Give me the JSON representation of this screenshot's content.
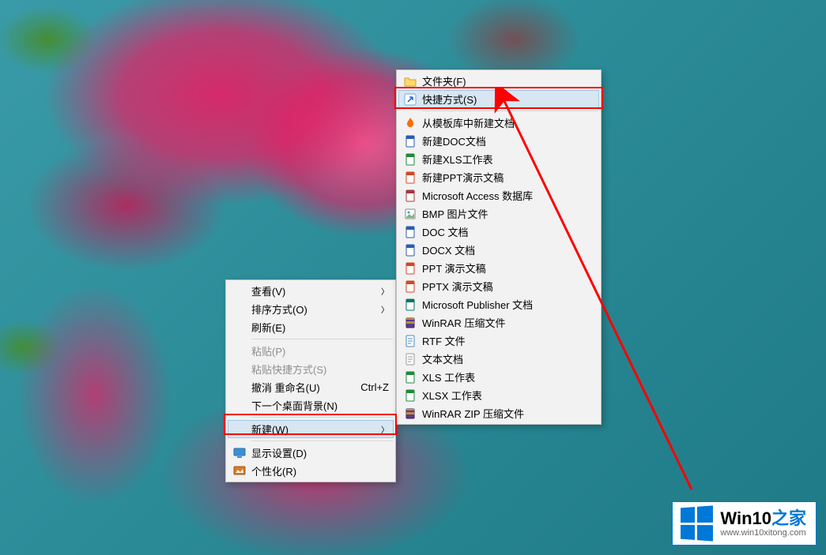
{
  "context_menu": {
    "view": "查看(V)",
    "sort": "排序方式(O)",
    "refresh": "刷新(E)",
    "paste": "粘贴(P)",
    "paste_shortcut": "粘贴快捷方式(S)",
    "undo_rename": "撤消 重命名(U)",
    "undo_shortcut": "Ctrl+Z",
    "next_bg": "下一个桌面背景(N)",
    "new": "新建(W)",
    "display": "显示设置(D)",
    "personalize": "个性化(R)"
  },
  "new_submenu": {
    "items": [
      {
        "label": "文件夹(F)",
        "icon": "folder"
      },
      {
        "label": "快捷方式(S)",
        "icon": "shortcut",
        "highlight": true
      },
      {
        "label": "从模板库中新建文档",
        "icon": "flame"
      },
      {
        "label": "新建DOC文档",
        "icon": "doc"
      },
      {
        "label": "新建XLS工作表",
        "icon": "xls"
      },
      {
        "label": "新建PPT演示文稿",
        "icon": "ppt"
      },
      {
        "label": "Microsoft Access 数据库",
        "icon": "access"
      },
      {
        "label": "BMP 图片文件",
        "icon": "bmp"
      },
      {
        "label": "DOC 文档",
        "icon": "doc"
      },
      {
        "label": "DOCX 文档",
        "icon": "doc"
      },
      {
        "label": "PPT 演示文稿",
        "icon": "ppt"
      },
      {
        "label": "PPTX 演示文稿",
        "icon": "ppt"
      },
      {
        "label": "Microsoft Publisher 文档",
        "icon": "pub"
      },
      {
        "label": "WinRAR 压缩文件",
        "icon": "rar"
      },
      {
        "label": "RTF 文件",
        "icon": "rtf"
      },
      {
        "label": "文本文档",
        "icon": "txt"
      },
      {
        "label": "XLS 工作表",
        "icon": "xls"
      },
      {
        "label": "XLSX 工作表",
        "icon": "xls"
      },
      {
        "label": "WinRAR ZIP 压缩文件",
        "icon": "rar"
      }
    ]
  },
  "watermark": {
    "title_main": "Win10",
    "title_accent": "之家",
    "url": "www.win10xitong.com"
  },
  "colors": {
    "highlight_border": "#ff0000",
    "menu_hover_bg": "#d8e6f2",
    "win_blue": "#0078d7"
  }
}
